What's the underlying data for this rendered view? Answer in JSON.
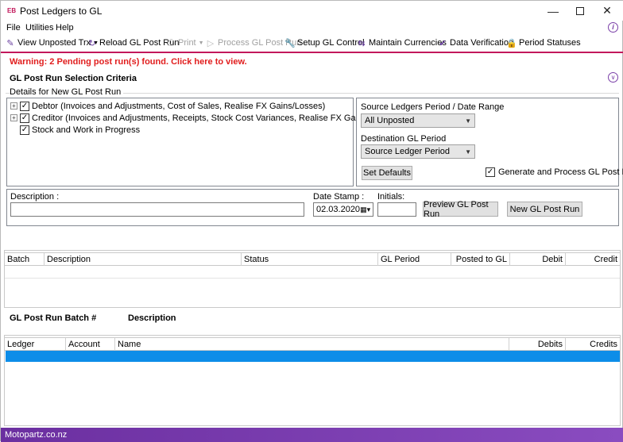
{
  "window": {
    "logo": "EB",
    "title": "Post Ledgers to GL"
  },
  "menu": {
    "file": "File",
    "utilities": "Utilities",
    "help": "Help"
  },
  "toolbar": {
    "view_unposted": "View Unposted Trx",
    "reload": "Reload GL Post Run",
    "print": "Print",
    "process": "Process GL Post Run",
    "setup": "Setup GL Control",
    "currencies": "Maintain Currencies",
    "verification": "Data Verification",
    "period_statuses": "Period Statuses"
  },
  "warning": "Warning: 2 Pending post run(s) found. Click here to view.",
  "criteria": {
    "title": "GL Post Run Selection Criteria",
    "details_label": "Details for New GL Post Run",
    "tree": [
      {
        "label": "Debtor (Invoices and Adjustments, Cost of Sales, Realise FX Gains/Losses)",
        "checked": true,
        "expandable": true
      },
      {
        "label": "Creditor (Invoices and Adjustments, Receipts, Stock Cost Variances, Realise FX Gains/Losses)",
        "checked": true,
        "expandable": true
      },
      {
        "label": "Stock and Work in Progress",
        "checked": true,
        "expandable": false
      }
    ],
    "source_label": "Source Ledgers Period / Date Range",
    "source_value": "All Unposted",
    "dest_label": "Destination GL Period",
    "dest_value": "Source Ledger Period",
    "set_defaults": "Set Defaults",
    "generate_label": "Generate and Process GL Post Run",
    "generate_checked": true
  },
  "form": {
    "description_label": "Description :",
    "description_value": "",
    "date_label": "Date Stamp :",
    "date_value": "02.03.2020",
    "initials_label": "Initials:",
    "initials_value": "",
    "preview_button": "Preview GL Post Run",
    "new_button": "New GL Post Run"
  },
  "batch_grid": {
    "columns": [
      "Batch",
      "Description",
      "Status",
      "GL Period",
      "Posted to GL",
      "Debit",
      "Credit"
    ]
  },
  "detail_header": {
    "batch_label": "GL Post Run Batch #",
    "description_label": "Description"
  },
  "ledger_grid": {
    "columns": [
      "Ledger",
      "Account",
      "Name",
      "Debits",
      "Credits"
    ],
    "selected_row_color": "#0d8de8"
  },
  "status_bar": {
    "text": "Motopartz.co.nz"
  },
  "colors": {
    "accent": "#c2185b",
    "warning": "#e11d1d",
    "brand_purple": "#7a3fa8"
  }
}
